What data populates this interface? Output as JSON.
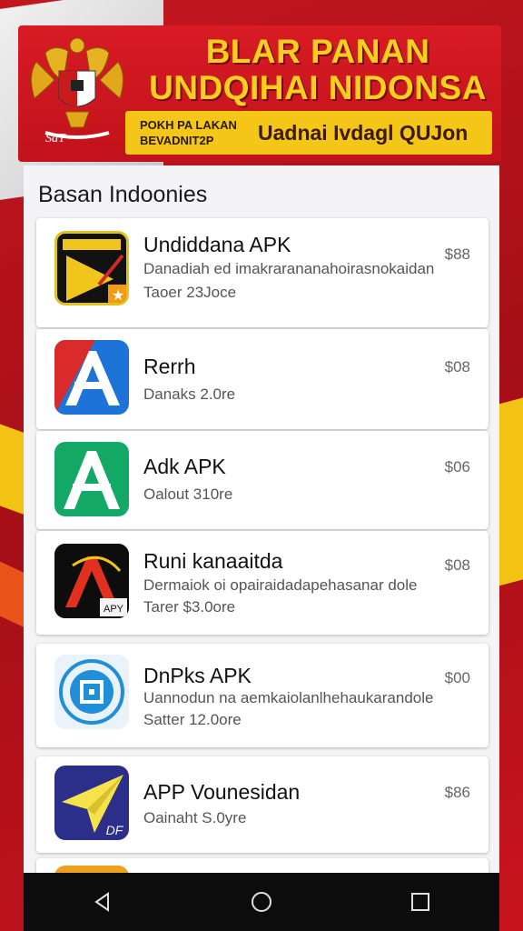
{
  "header": {
    "title_line1": "BLAR PANAN",
    "title_line2": "UNDQIHAI NIDONSA",
    "banner_small_line1": "POKH PA LAKAN",
    "banner_small_line2": "BEVADNIT2P",
    "banner_big": "Uadnai Ivdagl QUJon",
    "emblem_caption": "SaT"
  },
  "section": {
    "title": "Basan Indoonies"
  },
  "apps": [
    {
      "name": "Undiddana APK",
      "desc": "Danadiah ed imakrarananahoirasnokaidan",
      "meta": "Taoer 23Joce",
      "price": "$88",
      "icon": "undiddana-app-icon"
    },
    {
      "name": "Rerrh",
      "desc": "",
      "meta": "Danaks 2.0re",
      "price": "$08",
      "icon": "rerrh-app-icon"
    },
    {
      "name": "Adk APK",
      "desc": "",
      "meta": "Oalout 310re",
      "price": "$06",
      "icon": "adk-app-icon"
    },
    {
      "name": "Runi kanaaitda",
      "desc": "Dermaiok oi opairaidadapehasanar dole",
      "meta": "Tarer $3.0ore",
      "price": "$08",
      "icon": "runi-app-icon"
    },
    {
      "name": "DnPks APK",
      "desc": "Uannodun na aemkaiolanlhehaukarandole",
      "meta": "Satter 12.0ore",
      "price": "$00",
      "icon": "dnpks-app-icon"
    },
    {
      "name": "APP Vounesidan",
      "desc": "",
      "meta": "Oainaht S.0yre",
      "price": "$86",
      "icon": "app-vounesidan-icon"
    }
  ],
  "navbar": {
    "back": "back-icon",
    "home": "home-icon",
    "recents": "recents-icon"
  },
  "colors": {
    "red": "#c1121b",
    "yellow": "#f4c617",
    "panel": "#f4f4f6"
  }
}
